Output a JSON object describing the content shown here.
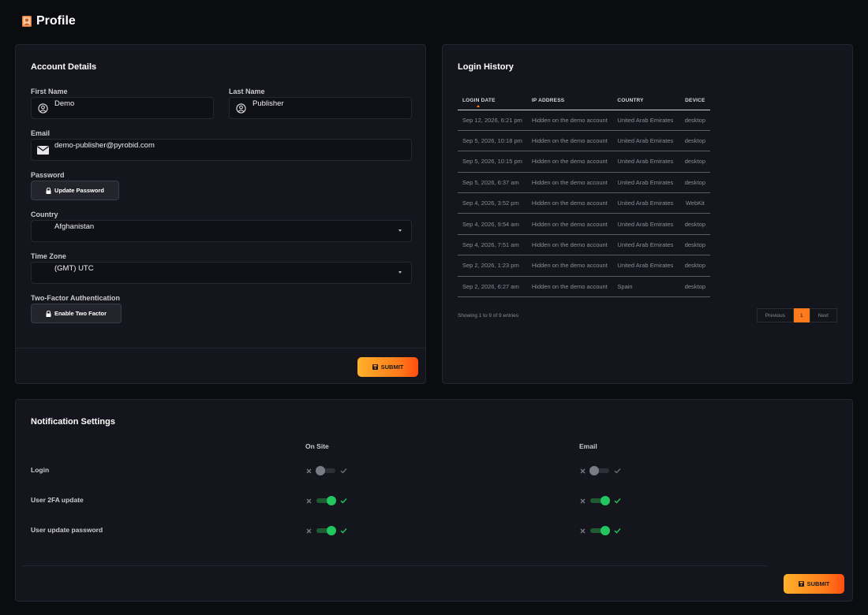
{
  "page": {
    "title": "Profile"
  },
  "colors": {
    "accent": "#ff7a1a",
    "success": "#22c55e",
    "background": "#0b0c10",
    "card": "#15161d"
  },
  "account": {
    "title": "Account Details",
    "first_name_label": "First Name",
    "first_name_value": "Demo",
    "last_name_label": "Last Name",
    "last_name_value": "Publisher",
    "email_label": "Email",
    "email_value": "demo-publisher@pyrobid.com",
    "password_label": "Password",
    "update_password_button": "Update Password",
    "country_label": "Country",
    "country_value": "Afghanistan",
    "timezone_label": "Time Zone",
    "timezone_value": "(GMT) UTC",
    "twofa_label": "Two-Factor Authentication",
    "twofa_button": "Enable Two Factor",
    "submit_button": "SUBMIT"
  },
  "login_history": {
    "title": "Login History",
    "columns": [
      "LOGIN DATE",
      "IP ADDRESS",
      "COUNTRY",
      "DEVICE"
    ],
    "rows": [
      [
        "Sep 12, 2026, 6:21 pm",
        "Hidden on the demo account",
        "United Arab Emirates",
        "desktop"
      ],
      [
        "Sep 5, 2026, 10:18 pm",
        "Hidden on the demo account",
        "United Arab Emirates",
        "desktop"
      ],
      [
        "Sep 5, 2026, 10:15 pm",
        "Hidden on the demo account",
        "United Arab Emirates",
        "desktop"
      ],
      [
        "Sep 5, 2026, 6:37 am",
        "Hidden on the demo account",
        "United Arab Emirates",
        "desktop"
      ],
      [
        "Sep 4, 2026, 3:52 pm",
        "Hidden on the demo account",
        "United Arab Emirates",
        "WebKit"
      ],
      [
        "Sep 4, 2026, 9:54 am",
        "Hidden on the demo account",
        "United Arab Emirates",
        "desktop"
      ],
      [
        "Sep 4, 2026, 7:51 am",
        "Hidden on the demo account",
        "United Arab Emirates",
        "desktop"
      ],
      [
        "Sep 2, 2026, 1:23 pm",
        "Hidden on the demo account",
        "United Arab Emirates",
        "desktop"
      ],
      [
        "Sep 2, 2026, 6:27 am",
        "Hidden on the demo account",
        "Spain",
        "desktop"
      ]
    ],
    "showing_text": "Showing 1 to 9 of 9 entries",
    "pagination": {
      "previous": "Previous",
      "current_page": "1",
      "next": "Next"
    }
  },
  "notifications": {
    "title": "Notification Settings",
    "column_onsite": "On Site",
    "column_email": "Email",
    "rows": [
      {
        "label": "Login",
        "onsite": false,
        "email": false
      },
      {
        "label": "User 2FA update",
        "onsite": true,
        "email": true
      },
      {
        "label": "User update password",
        "onsite": true,
        "email": true
      }
    ],
    "submit_button": "SUBMIT"
  }
}
